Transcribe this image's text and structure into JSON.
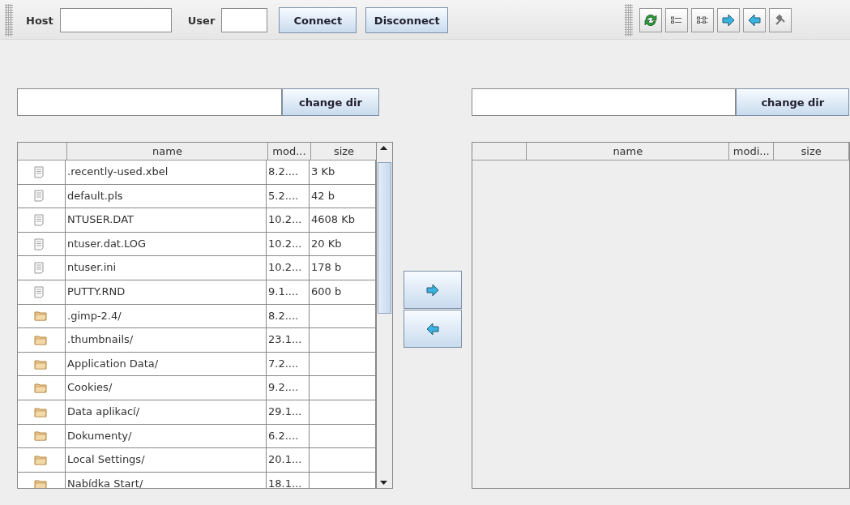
{
  "connection": {
    "host_label": "Host",
    "user_label": "User",
    "buttons": [
      "Connect",
      "Disconnect"
    ]
  },
  "toolbar": {
    "tools": [
      {
        "kind": "refresh"
      },
      {
        "kind": "list"
      },
      {
        "kind": "details"
      },
      {
        "kind": "right"
      },
      {
        "kind": "left"
      },
      {
        "kind": "tools"
      }
    ]
  },
  "local": {
    "change_dir": "change dir",
    "columns": [
      "name",
      "mod...",
      "size"
    ],
    "rows": [
      {
        "kind": "file",
        "name": ".recently-used.xbel",
        "modified": "8.2....",
        "size": "3 Kb"
      },
      {
        "kind": "file",
        "name": "default.pls",
        "modified": "5.2....",
        "size": "42 b"
      },
      {
        "kind": "file",
        "name": "NTUSER.DAT",
        "modified": "10.2...",
        "size": "4608 Kb"
      },
      {
        "kind": "file",
        "name": "ntuser.dat.LOG",
        "modified": "10.2...",
        "size": "20 Kb"
      },
      {
        "kind": "file",
        "name": "ntuser.ini",
        "modified": "10.2...",
        "size": "178 b"
      },
      {
        "kind": "file",
        "name": "PUTTY.RND",
        "modified": "9.1....",
        "size": "600 b"
      },
      {
        "kind": "folder",
        "name": ".gimp-2.4/",
        "modified": "8.2...."
      },
      {
        "kind": "folder",
        "name": ".thumbnails/",
        "modified": "23.1..."
      },
      {
        "kind": "folder",
        "name": "Application Data/",
        "modified": "7.2...."
      },
      {
        "kind": "folder",
        "name": "Cookies/",
        "modified": "9.2...."
      },
      {
        "kind": "folder",
        "name": "Data aplikací/",
        "modified": "29.1..."
      },
      {
        "kind": "folder",
        "name": "Dokumenty/",
        "modified": "6.2...."
      },
      {
        "kind": "folder",
        "name": "Local Settings/",
        "modified": "20.1..."
      },
      {
        "kind": "folder",
        "name": "Nabídka Start/",
        "modified": "18.1..."
      }
    ]
  },
  "transfer": [
    {
      "kind": "right"
    },
    {
      "kind": "left"
    }
  ],
  "remote": {
    "change_dir": "change dir",
    "columns": [
      "name",
      "modi...",
      "size"
    ]
  }
}
